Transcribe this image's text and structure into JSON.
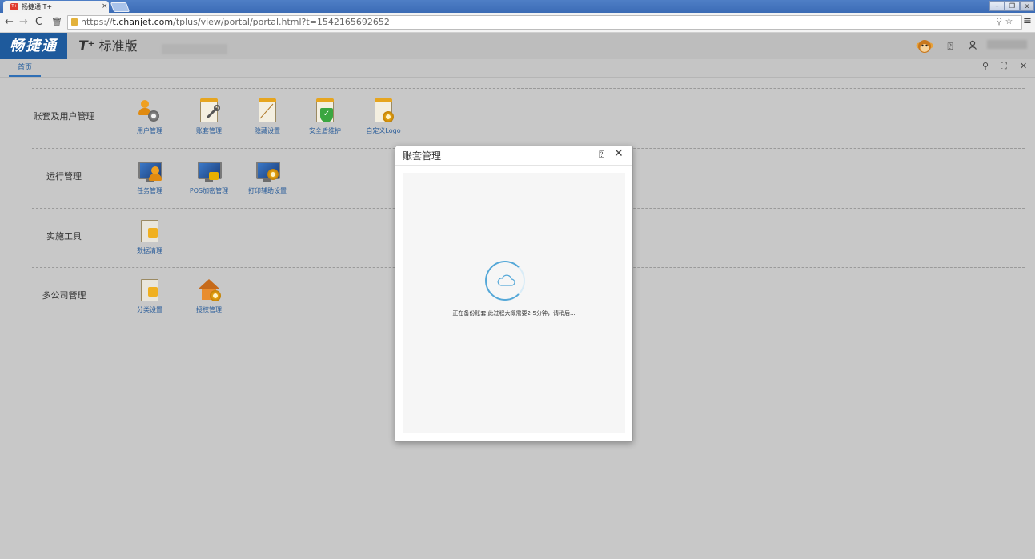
{
  "browser": {
    "tab_title": "畅捷通 T+",
    "tab_close": "×",
    "favicon_text": "T+",
    "url_prefix": "https://",
    "url_host": "t.chanjet.com",
    "url_path": "/tplus/view/portal/portal.html?t=1542165692652"
  },
  "app": {
    "brand": "畅捷通",
    "product_prefix": "T⁺",
    "product_name": "标准版"
  },
  "page_tabs": {
    "home": "首页"
  },
  "sections": [
    {
      "title": "账套及用户管理",
      "tools": [
        "用户管理",
        "账套管理",
        "隐藏设置",
        "安全盾维护",
        "自定义Logo"
      ]
    },
    {
      "title": "运行管理",
      "tools": [
        "任务管理",
        "POS加密管理",
        "打印辅助设置"
      ]
    },
    {
      "title": "实施工具",
      "tools": [
        "数据清理"
      ]
    },
    {
      "title": "多公司管理",
      "tools": [
        "分类设置",
        "授权管理"
      ]
    }
  ],
  "dialog": {
    "title": "账套管理",
    "message": "正在备份账套,此过程大概需要2-5分钟，请稍后..."
  },
  "colors": {
    "brand": "#1e5a9c",
    "link": "#2a5d9a",
    "spinner": "#55a8d8"
  }
}
